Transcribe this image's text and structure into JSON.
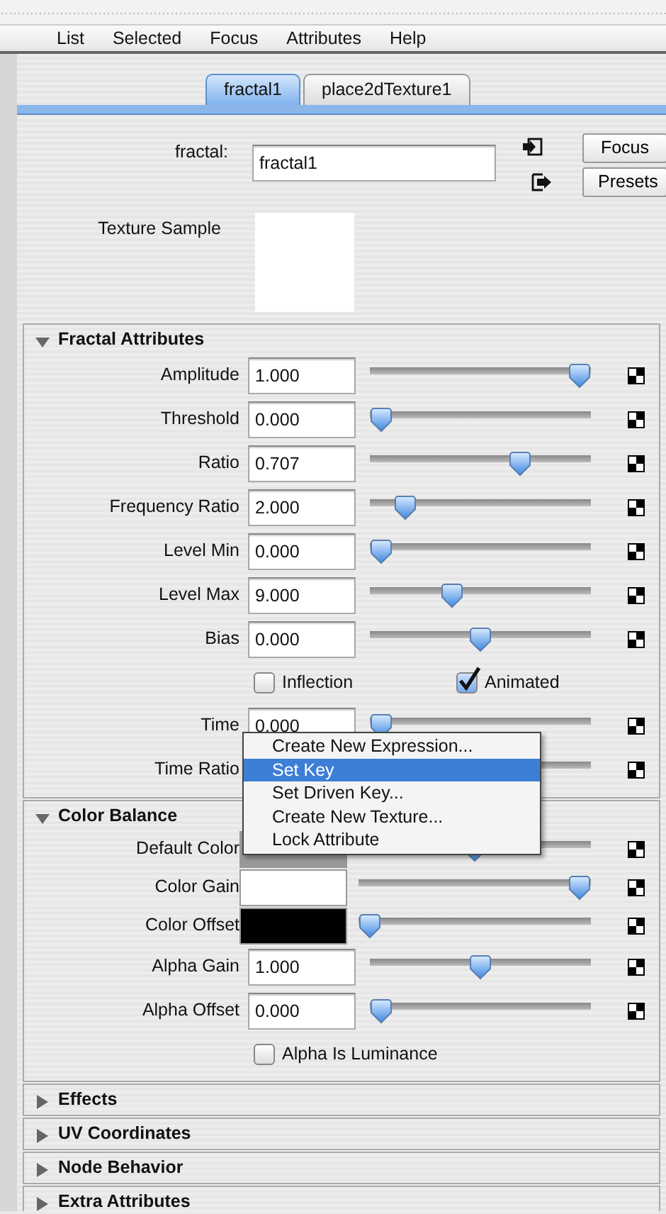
{
  "menubar": [
    "List",
    "Selected",
    "Focus",
    "Attributes",
    "Help"
  ],
  "tabs": [
    {
      "label": "fractal1",
      "selected": true
    },
    {
      "label": "place2dTexture1",
      "selected": false
    }
  ],
  "node": {
    "label": "fractal:",
    "value": "fractal1"
  },
  "buttons": [
    "Focus",
    "Presets"
  ],
  "texture_sample": {
    "label": "Texture Sample"
  },
  "sections": [
    {
      "title": "Fractal Attributes",
      "expanded": true,
      "rows": [
        {
          "kind": "number",
          "label": "Amplitude",
          "value": "1.000",
          "level": 1.0
        },
        {
          "kind": "number",
          "label": "Threshold",
          "value": "0.000",
          "level": 0
        },
        {
          "kind": "number",
          "label": "Ratio",
          "value": "0.707",
          "level": 0.7
        },
        {
          "kind": "number",
          "label": "Frequency Ratio",
          "value": "2.000",
          "level": 0.12
        },
        {
          "kind": "number",
          "label": "Level Min",
          "value": "0.000",
          "level": 0
        },
        {
          "kind": "number",
          "label": "Level Max",
          "value": "9.000",
          "level": 0.36
        },
        {
          "kind": "number",
          "label": "Bias",
          "value": "0.000",
          "level": 0.5
        },
        {
          "kind": "checkboxes",
          "items": [
            {
              "label": "Inflection",
              "checked": false
            },
            {
              "label": "Animated",
              "checked": true
            }
          ]
        },
        {
          "kind": "number",
          "label": "Time",
          "value": "0.000",
          "level": 0
        },
        {
          "kind": "number",
          "label": "Time Ratio"
        }
      ]
    },
    {
      "title": "Color Balance",
      "expanded": true,
      "rows": [
        {
          "kind": "color",
          "label": "Default Color",
          "color": "#999999",
          "level": 0.5
        },
        {
          "kind": "color",
          "label": "Color Gain",
          "color": "#ffffff",
          "level": 1.0
        },
        {
          "kind": "color",
          "label": "Color Offset",
          "color": "#000000",
          "level": 0
        },
        {
          "kind": "number",
          "label": "Alpha Gain",
          "value": "1.000",
          "level": 0.5
        },
        {
          "kind": "number",
          "label": "Alpha Offset",
          "value": "0.000",
          "level": 0
        },
        {
          "kind": "checkboxes",
          "items": [
            {
              "label": "Alpha Is Luminance",
              "checked": false
            }
          ]
        }
      ]
    },
    {
      "title": "Effects",
      "expanded": false
    },
    {
      "title": "UV Coordinates",
      "expanded": false
    },
    {
      "title": "Node Behavior",
      "expanded": false
    },
    {
      "title": "Extra Attributes",
      "expanded": false
    }
  ],
  "context_menu": {
    "items": [
      {
        "label": "Create New Expression...",
        "selected": false
      },
      {
        "label": "Set Key",
        "selected": true
      },
      {
        "label": "Set Driven Key...",
        "selected": false
      },
      {
        "label": "Create New Texture...",
        "selected": false
      },
      {
        "label": "Lock Attribute",
        "selected": false
      }
    ]
  }
}
